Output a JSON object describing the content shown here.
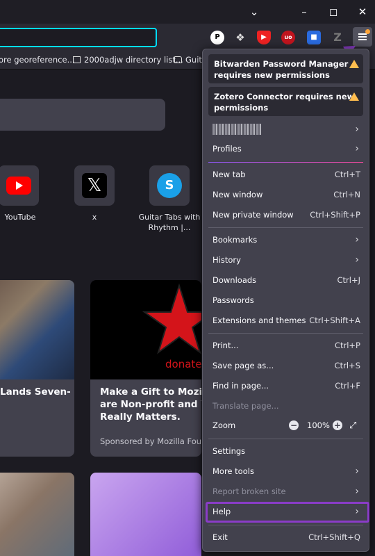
{
  "bookmarks": [
    {
      "label": "ore georeference..."
    },
    {
      "label": "2000adjw directory list..."
    },
    {
      "label": "Guita"
    }
  ],
  "top_sites": [
    {
      "label": "YouTube"
    },
    {
      "label": "x"
    },
    {
      "label": "Guitar Tabs with Rhythm |..."
    }
  ],
  "cards": [
    {
      "title": "Lands Seven-"
    },
    {
      "title": "Make a Gift to Mozilla F... are Non-profit and Your ... Really Matters.",
      "title_lines": [
        "Make a Gift to Mozilla F",
        "are Non-profit and Your",
        "Really Matters."
      ],
      "sponsor": "Sponsored by Mozilla Found"
    },
    {
      "image_text": "donate"
    }
  ],
  "menu": {
    "notices": [
      {
        "text": "Bitwarden Password Manager requires new permissions"
      },
      {
        "text": "Zotero Connector requires new permissions"
      }
    ],
    "profiles": "Profiles",
    "new_tab": {
      "label": "New tab",
      "shortcut": "Ctrl+T"
    },
    "new_window": {
      "label": "New window",
      "shortcut": "Ctrl+N"
    },
    "new_private_window": {
      "label": "New private window",
      "shortcut": "Ctrl+Shift+P"
    },
    "bookmarks": "Bookmarks",
    "history": "History",
    "downloads": {
      "label": "Downloads",
      "shortcut": "Ctrl+J"
    },
    "passwords": "Passwords",
    "extensions": {
      "label": "Extensions and themes",
      "shortcut": "Ctrl+Shift+A"
    },
    "print": {
      "label": "Print...",
      "shortcut": "Ctrl+P"
    },
    "save_page": {
      "label": "Save page as...",
      "shortcut": "Ctrl+S"
    },
    "find": {
      "label": "Find in page...",
      "shortcut": "Ctrl+F"
    },
    "translate": "Translate page...",
    "zoom": {
      "label": "Zoom",
      "value": "100%",
      "minus": "−",
      "plus": "+"
    },
    "settings": "Settings",
    "more_tools": "More tools",
    "report": "Report broken site",
    "help": "Help",
    "exit": {
      "label": "Exit",
      "shortcut": "Ctrl+Shift+Q"
    }
  },
  "colors": {
    "accent_arrow": "#8a3cc8",
    "urlbar_focus": "#00ddff",
    "warning": "#ffbd4f"
  }
}
